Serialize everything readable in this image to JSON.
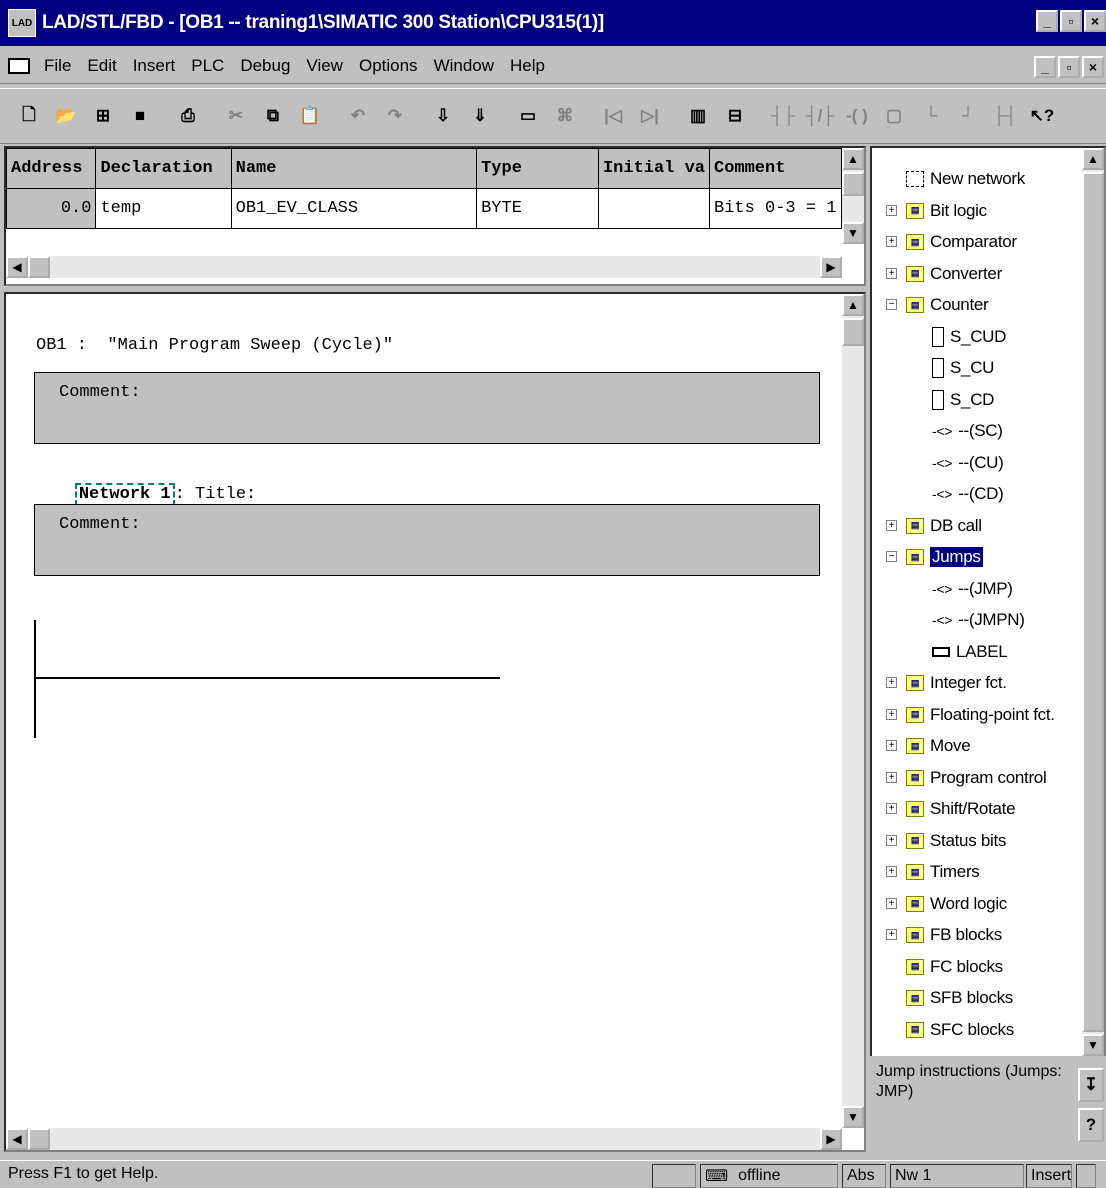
{
  "window": {
    "title": "LAD/STL/FBD  - [OB1 -- traning1\\SIMATIC 300 Station\\CPU315(1)]"
  },
  "menu": [
    "File",
    "Edit",
    "Insert",
    "PLC",
    "Debug",
    "View",
    "Options",
    "Window",
    "Help"
  ],
  "declaration_table": {
    "headers": [
      "Address",
      "Declaration",
      "Name",
      "Type",
      "Initial va",
      "Comment"
    ],
    "rows": [
      [
        "0.0",
        "temp",
        "OB1_EV_CLASS",
        "BYTE",
        "",
        "Bits 0-3 = 1"
      ]
    ]
  },
  "editor": {
    "block_title": "OB1 :  \"Main Program Sweep (Cycle)\"",
    "block_comment_label": "Comment:",
    "network_label": "Network 1",
    "network_title_suffix": ": Title:",
    "network_comment_label": "Comment:"
  },
  "catalog": {
    "items": [
      {
        "label": "New network",
        "icon": "new-network-icon",
        "expander": "none"
      },
      {
        "label": "Bit logic",
        "icon": "folder-icon",
        "expander": "+"
      },
      {
        "label": "Comparator",
        "icon": "folder-icon",
        "expander": "+"
      },
      {
        "label": "Converter",
        "icon": "folder-icon",
        "expander": "+"
      },
      {
        "label": "Counter",
        "icon": "folder-icon",
        "expander": "-"
      },
      {
        "label": "S_CUD",
        "icon": "box-icon",
        "expander": "child"
      },
      {
        "label": "S_CU",
        "icon": "box-icon",
        "expander": "child"
      },
      {
        "label": "S_CD",
        "icon": "box-icon",
        "expander": "child"
      },
      {
        "label": "--(SC)",
        "icon": "coil-icon",
        "expander": "child"
      },
      {
        "label": "--(CU)",
        "icon": "coil-icon",
        "expander": "child"
      },
      {
        "label": "--(CD)",
        "icon": "coil-icon",
        "expander": "child"
      },
      {
        "label": "DB call",
        "icon": "folder-icon",
        "expander": "+"
      },
      {
        "label": "Jumps",
        "icon": "folder-icon",
        "expander": "-",
        "selected": true
      },
      {
        "label": "--(JMP)",
        "icon": "coil-icon",
        "expander": "child"
      },
      {
        "label": "--(JMPN)",
        "icon": "coil-icon",
        "expander": "child"
      },
      {
        "label": "LABEL",
        "icon": "label-icon",
        "expander": "child"
      },
      {
        "label": "Integer fct.",
        "icon": "folder-icon",
        "expander": "+"
      },
      {
        "label": "Floating-point fct.",
        "icon": "folder-icon",
        "expander": "+"
      },
      {
        "label": "Move",
        "icon": "folder-icon",
        "expander": "+"
      },
      {
        "label": "Program control",
        "icon": "folder-icon",
        "expander": "+"
      },
      {
        "label": "Shift/Rotate",
        "icon": "folder-icon",
        "expander": "+"
      },
      {
        "label": "Status bits",
        "icon": "folder-icon",
        "expander": "+"
      },
      {
        "label": "Timers",
        "icon": "folder-icon",
        "expander": "+"
      },
      {
        "label": "Word logic",
        "icon": "folder-icon",
        "expander": "+"
      },
      {
        "label": "FB blocks",
        "icon": "folder-icon",
        "expander": "+"
      },
      {
        "label": "FC blocks",
        "icon": "folder-icon",
        "expander": "none"
      },
      {
        "label": "SFB blocks",
        "icon": "folder-icon",
        "expander": "none"
      },
      {
        "label": "SFC blocks",
        "icon": "folder-icon",
        "expander": "none"
      }
    ],
    "info_text": "Jump instructions (Jumps: JMP)"
  },
  "status": {
    "help": "Press F1 to get Help.",
    "connection": "offline",
    "mode": "Abs",
    "network": "Nw 1",
    "insert": "Insert"
  },
  "colors": {
    "titlebar": "#000080",
    "face": "#c0c0c0"
  }
}
